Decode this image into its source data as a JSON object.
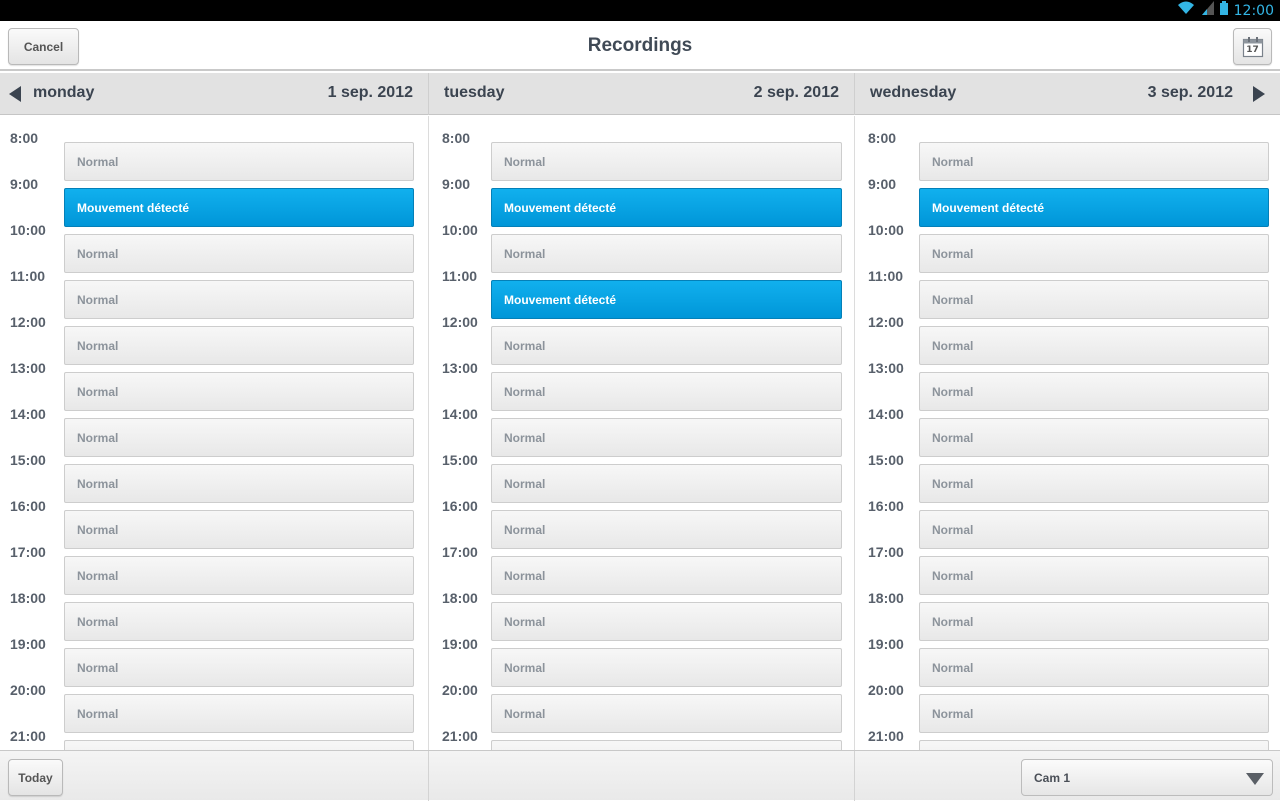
{
  "status": {
    "time": "12:00",
    "accent": "#33b5e5"
  },
  "actionbar": {
    "cancel_label": "Cancel",
    "title": "Recordings",
    "calendar_day": "17"
  },
  "days": [
    {
      "name": "monday",
      "date": "1 sep. 2012"
    },
    {
      "name": "tuesday",
      "date": "2 sep. 2012"
    },
    {
      "name": "wednesday",
      "date": "3 sep. 2012"
    }
  ],
  "hours": [
    "8:00",
    "9:00",
    "10:00",
    "11:00",
    "12:00",
    "13:00",
    "14:00",
    "15:00",
    "16:00",
    "17:00",
    "18:00",
    "19:00",
    "20:00",
    "21:00"
  ],
  "schedule": [
    [
      "Normal",
      "Mouvement détecté",
      "Normal",
      "Normal",
      "Normal",
      "Normal",
      "Normal",
      "Normal",
      "Normal",
      "Normal",
      "Normal",
      "Normal",
      "Normal",
      ""
    ],
    [
      "Normal",
      "Mouvement détecté",
      "Normal",
      "Mouvement détecté",
      "Normal",
      "Normal",
      "Normal",
      "Normal",
      "Normal",
      "Normal",
      "Normal",
      "Normal",
      "Normal",
      ""
    ],
    [
      "Normal",
      "Mouvement détecté",
      "Normal",
      "Normal",
      "Normal",
      "Normal",
      "Normal",
      "Normal",
      "Normal",
      "Normal",
      "Normal",
      "Normal",
      "Normal",
      ""
    ]
  ],
  "bottombar": {
    "today_label": "Today",
    "camera_selected": "Cam 1"
  },
  "colors": {
    "motion": "#0aa6e6",
    "normal": "#efefef"
  }
}
